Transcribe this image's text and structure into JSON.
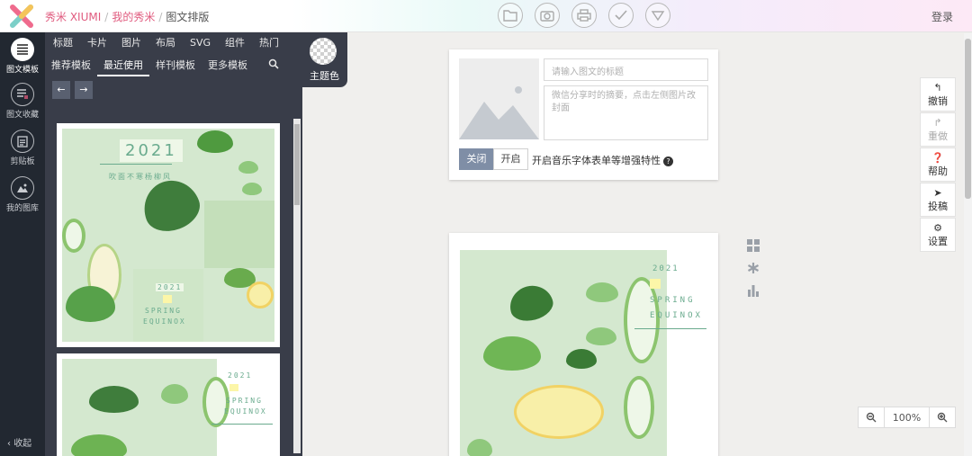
{
  "header": {
    "brand": "秀米 XIUMI",
    "breadcrumb_mine": "我的秀米",
    "breadcrumb_current": "图文排版",
    "separator": "/",
    "login": "登录",
    "tool_icons": [
      "folder-icon",
      "camera-icon",
      "printer-icon",
      "check-icon",
      "triangle-down-icon"
    ]
  },
  "rail": {
    "items": [
      {
        "label": "图文模板",
        "icon": "list-icon"
      },
      {
        "label": "图文收藏",
        "icon": "favorite-list-icon"
      },
      {
        "label": "剪贴板",
        "icon": "clipboard-icon"
      },
      {
        "label": "我的图库",
        "icon": "gallery-icon"
      }
    ],
    "collapse": "收起"
  },
  "panel": {
    "tabs_primary": [
      "标题",
      "卡片",
      "图片",
      "布局",
      "SVG",
      "组件",
      "热门"
    ],
    "tabs_secondary": [
      "推荐模板",
      "最近使用",
      "样刊模板",
      "更多模板"
    ],
    "active_secondary": "最近使用",
    "template1": {
      "year": "2021",
      "subtitle": "吹面不寒杨柳风",
      "tag": "2021",
      "line1": "SPRING",
      "line2": "EQUINOX"
    },
    "template2": {
      "tag": "2021",
      "line1": "SPRING",
      "line2": "EQUINOX"
    }
  },
  "theme": {
    "label": "主题色"
  },
  "meta": {
    "title_placeholder": "请输入图文的标题",
    "desc_placeholder": "微信分享时的摘要，点击左侧图片改封面",
    "switch_off": "关闭",
    "switch_on": "开启",
    "music_label": "开启音乐字体表单等增强特性"
  },
  "paper": {
    "tag": "2021",
    "line1": "SPRING",
    "line2": "EQUINOX"
  },
  "right_tools": [
    {
      "label": "撤销",
      "icon": "undo-icon",
      "enabled": true
    },
    {
      "label": "重做",
      "icon": "redo-icon",
      "enabled": false
    },
    {
      "label": "帮助",
      "icon": "help-icon",
      "enabled": true
    },
    {
      "label": "投稿",
      "icon": "send-icon",
      "enabled": true
    },
    {
      "label": "设置",
      "icon": "gear-icon",
      "enabled": true
    }
  ],
  "zoom": {
    "value": "100%"
  },
  "colors": {
    "accent": "#e05a7e",
    "dark": "#393d49",
    "rail": "#222831",
    "toggle_off": "#7f8ea6"
  }
}
